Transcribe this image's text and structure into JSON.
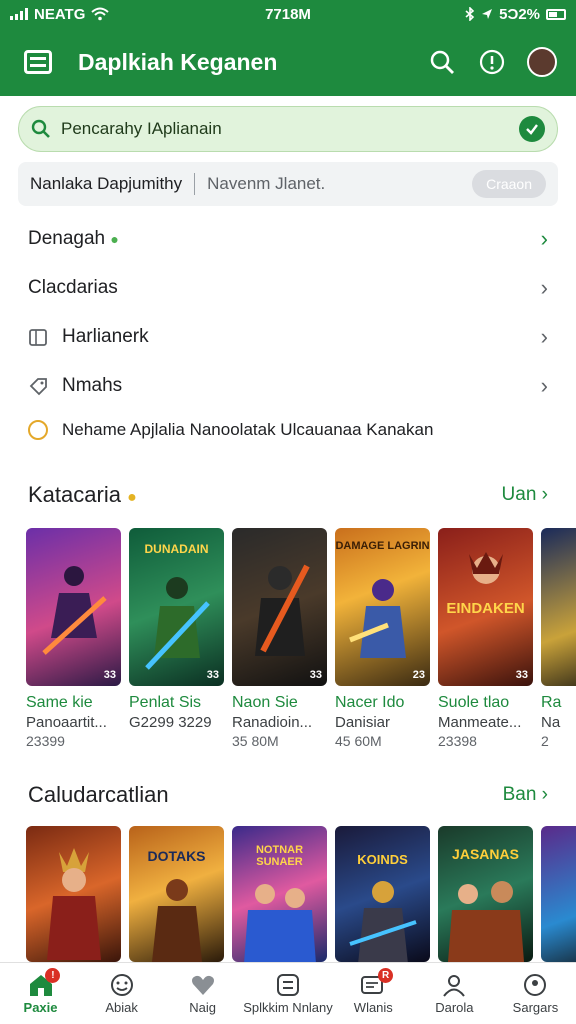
{
  "status_bar": {
    "carrier": "NEATG",
    "time": "7718M",
    "battery": "5Ɔ2%"
  },
  "app_bar": {
    "title": "Daplkiah Keganen"
  },
  "search": {
    "placeholder": "Pencarahy IAplianain"
  },
  "filter": {
    "left_label": "Nanlaka Dapjumithy",
    "right_label": "Navenm Jlanet.",
    "button": "Craaon"
  },
  "menu": [
    {
      "label": "Denagah",
      "accent": true
    },
    {
      "label": "Clacdarias"
    },
    {
      "label": "Harlianerk"
    },
    {
      "label": "Nmahs"
    }
  ],
  "notice": "Nehame Apjlalia Nanoolatak Ulcauanaa Kanakan",
  "section1": {
    "title": "Katacaria",
    "more": "Uan",
    "items": [
      {
        "name": "Same kie",
        "sub": "Panoaartit...",
        "size": "23399",
        "badge": "33"
      },
      {
        "name": "Penlat Sis",
        "sub": "G2299 3229",
        "size": "",
        "badge": "33"
      },
      {
        "name": "Naon Sie",
        "sub": "Ranadioin...",
        "size": "35 80M",
        "badge": "33"
      },
      {
        "name": "Nacer Ido",
        "sub": "Danisiar",
        "size": "45 60M",
        "badge": "23"
      },
      {
        "name": "Suole tlao",
        "sub": "Manmeate...",
        "size": "23398",
        "badge": "33"
      },
      {
        "name": "Ra",
        "sub": "Na",
        "size": "2",
        "badge": ""
      }
    ],
    "card_texts": [
      "",
      "DUNADAIN",
      "",
      "DAMAGE LAGRIN",
      "EINDAKEN",
      ""
    ]
  },
  "section2": {
    "title": "Caludarcatlian",
    "more": "Ban",
    "card_texts": [
      "",
      "DOTAKS",
      "NOTNAR SUNAER",
      "KOINDS",
      "JASANAS",
      ""
    ]
  },
  "bottom_nav": [
    {
      "label": "Paxie",
      "icon": "home-icon",
      "active": true,
      "badge": "!"
    },
    {
      "label": "Abiak",
      "icon": "games-icon"
    },
    {
      "label": "Naig",
      "icon": "heart-icon"
    },
    {
      "label": "Splkkim Nnlany",
      "icon": "apps-icon"
    },
    {
      "label": "Wlanis",
      "icon": "message-icon",
      "badge": "R"
    },
    {
      "label": "Darola",
      "icon": "person-icon"
    },
    {
      "label": "Sargars",
      "icon": "account-icon"
    }
  ],
  "colors": {
    "primary": "#1e8a3e",
    "search_bg": "#e1f3dc"
  }
}
